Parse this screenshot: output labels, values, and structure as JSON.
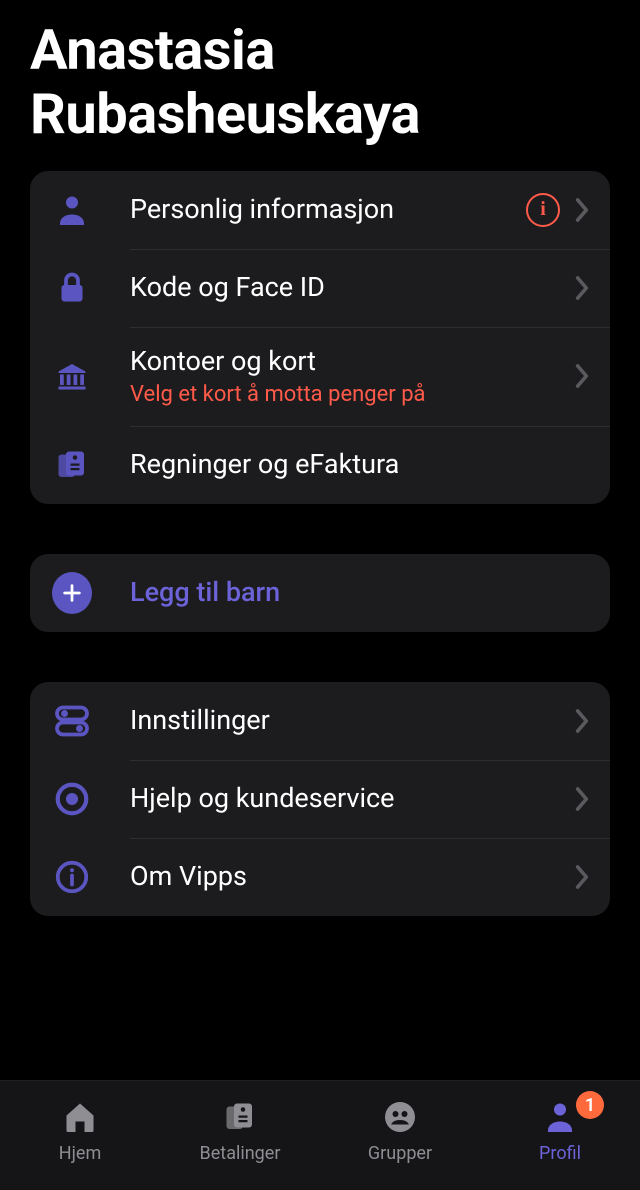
{
  "colors": {
    "accent": "#5b55c2",
    "accent_light": "#6c63d8",
    "alert": "#ff5a4a",
    "badge": "#ff6a3d",
    "card_bg": "#1c1c1e",
    "text": "#ffffff",
    "muted": "#8e8e93"
  },
  "header": {
    "name": "Anastasia Rubasheuskaya"
  },
  "section_account": [
    {
      "icon": "person-icon",
      "label": "Personlig informasjon",
      "sublabel": null,
      "alert": true,
      "chevron": true
    },
    {
      "icon": "lock-icon",
      "label": "Kode og Face ID",
      "sublabel": null,
      "alert": false,
      "chevron": true
    },
    {
      "icon": "bank-icon",
      "label": "Kontoer og kort",
      "sublabel": "Velg et kort å motta penger på",
      "alert": false,
      "chevron": true
    },
    {
      "icon": "bills-icon",
      "label": "Regninger og eFaktura",
      "sublabel": null,
      "alert": false,
      "chevron": false
    }
  ],
  "add_child": {
    "icon": "plus-icon",
    "label": "Legg til barn"
  },
  "section_support": [
    {
      "icon": "toggles-icon",
      "label": "Innstillinger",
      "chevron": true
    },
    {
      "icon": "help-icon",
      "label": "Hjelp og kundeservice",
      "chevron": true
    },
    {
      "icon": "info-icon",
      "label": "Om Vipps",
      "chevron": true
    }
  ],
  "tabs": [
    {
      "icon": "home-icon",
      "label": "Hjem",
      "active": false,
      "badge": null
    },
    {
      "icon": "payments-icon",
      "label": "Betalinger",
      "active": false,
      "badge": null
    },
    {
      "icon": "groups-icon",
      "label": "Grupper",
      "active": false,
      "badge": null
    },
    {
      "icon": "profile-icon",
      "label": "Profil",
      "active": true,
      "badge": "1"
    }
  ]
}
